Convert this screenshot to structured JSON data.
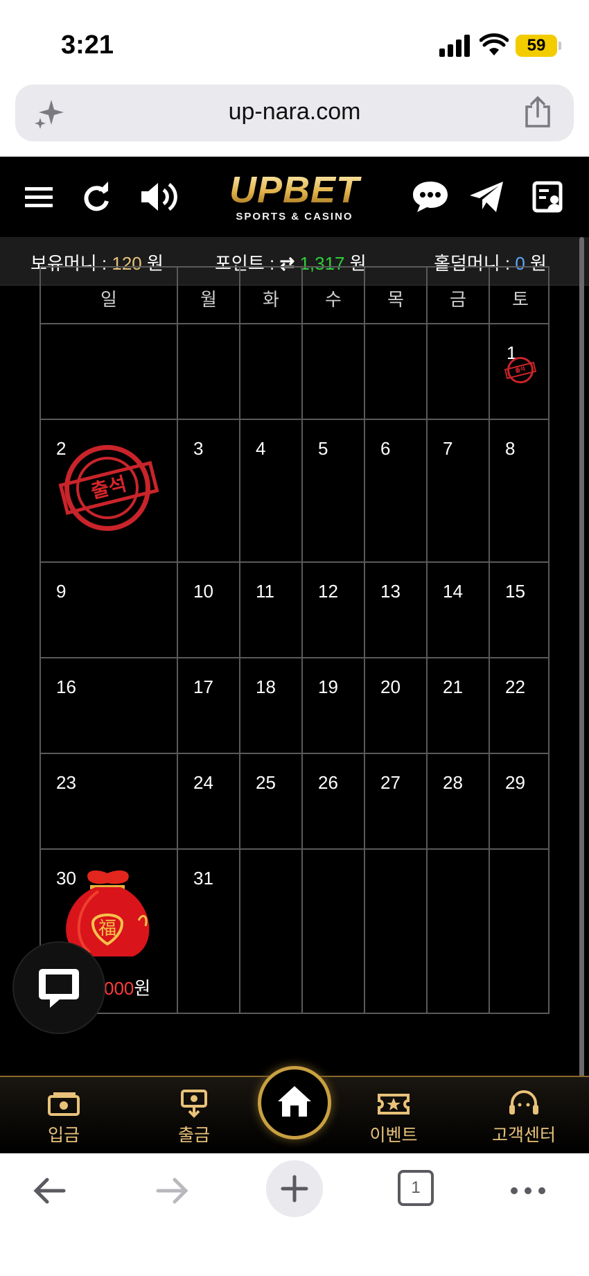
{
  "status_bar": {
    "time": "3:21",
    "battery": "59"
  },
  "browser": {
    "url": "up-nara.com",
    "tab_count": "1"
  },
  "header": {
    "logo_main": "UPBET",
    "logo_sub": "SPORTS & CASINO"
  },
  "money": {
    "holding_label": "보유머니 : ",
    "holding_value": "120",
    "holding_unit": " 원",
    "point_label": "포인트 : ",
    "point_value": "1,317",
    "point_unit": " 원",
    "holdem_label": "홀덤머니 : ",
    "holdem_value": "0",
    "holdem_unit": " 원"
  },
  "calendar": {
    "weekdays": [
      "일",
      "월",
      "화",
      "수",
      "목",
      "금",
      "토"
    ],
    "days": [
      "1",
      "2",
      "3",
      "4",
      "5",
      "6",
      "7",
      "8",
      "9",
      "10",
      "11",
      "12",
      "13",
      "14",
      "15",
      "16",
      "17",
      "18",
      "19",
      "20",
      "21",
      "22",
      "23",
      "24",
      "25",
      "26",
      "27",
      "28",
      "29",
      "30",
      "31"
    ],
    "stamp_text": "출석",
    "reward_red": "000",
    "reward_unit": "원"
  },
  "bottom_nav": [
    {
      "label": "입금"
    },
    {
      "label": "출금"
    },
    {
      "label": "이벤트"
    },
    {
      "label": "고객센터"
    }
  ],
  "colors": {
    "gold": "#e8c27a",
    "stamp_red": "#c9242a",
    "point_green": "#2fd13b",
    "holdem_blue": "#5fa8ff"
  }
}
